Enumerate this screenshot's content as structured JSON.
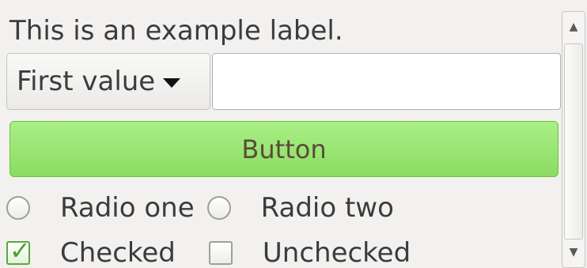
{
  "label": {
    "text": "This is an example label."
  },
  "combo": {
    "value": "First value",
    "arrow_icon": "dropdown-arrow-icon"
  },
  "entry": {
    "value": ""
  },
  "button": {
    "label": "Button"
  },
  "radios": [
    {
      "label": "Radio one",
      "selected": false
    },
    {
      "label": "Radio two",
      "selected": false
    }
  ],
  "checks": [
    {
      "label": "Checked",
      "checked": true
    },
    {
      "label": "Unchecked",
      "checked": false
    }
  ],
  "scrollbar": {
    "up_icon": "arrow-up-icon",
    "down_icon": "arrow-down-icon"
  },
  "colors": {
    "background": "#f2f1f0",
    "button_fill": "#9be671",
    "check_green": "#4ba22c",
    "text": "#3c3c3c"
  }
}
